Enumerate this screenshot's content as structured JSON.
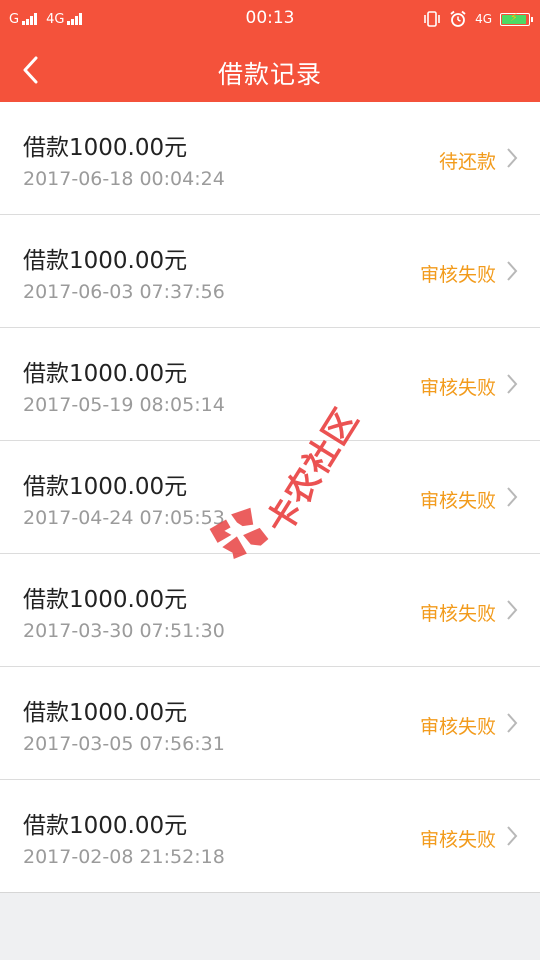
{
  "status_bar": {
    "carrier1": "G",
    "carrier2": "4G",
    "time": "00:13",
    "network": "4G"
  },
  "header": {
    "title": "借款记录"
  },
  "records": [
    {
      "amount": "借款1000.00元",
      "time": "2017-06-18 00:04:24",
      "status": "待还款"
    },
    {
      "amount": "借款1000.00元",
      "time": "2017-06-03 07:37:56",
      "status": "审核失败"
    },
    {
      "amount": "借款1000.00元",
      "time": "2017-05-19 08:05:14",
      "status": "审核失败"
    },
    {
      "amount": "借款1000.00元",
      "time": "2017-04-24 07:05:53",
      "status": "审核失败"
    },
    {
      "amount": "借款1000.00元",
      "time": "2017-03-30 07:51:30",
      "status": "审核失败"
    },
    {
      "amount": "借款1000.00元",
      "time": "2017-03-05 07:56:31",
      "status": "审核失败"
    },
    {
      "amount": "借款1000.00元",
      "time": "2017-02-08 21:52:18",
      "status": "审核失败"
    }
  ],
  "watermark": {
    "text": "卡农社区"
  },
  "colors": {
    "brand": "#f4523b",
    "status": "#f29b1c",
    "secondary_text": "#9b9b9b",
    "page_background": "#eff0f2"
  },
  "icons": {
    "back": "chevron-left-icon",
    "row_arrow": "chevron-right-icon",
    "vibrate": "vibrate-icon",
    "alarm": "alarm-icon",
    "battery": "battery-icon",
    "signal": "signal-icon"
  }
}
